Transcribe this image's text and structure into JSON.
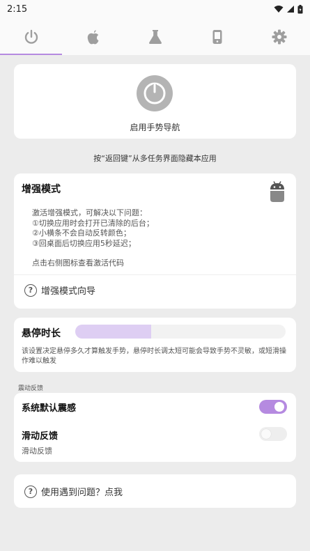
{
  "status_bar": {
    "time": "2:15",
    "icons": [
      "wifi-icon",
      "signal-icon",
      "battery-icon"
    ]
  },
  "tabs": [
    {
      "icon": "power-icon",
      "active": true
    },
    {
      "icon": "apple-icon",
      "active": false
    },
    {
      "icon": "flask-icon",
      "active": false
    },
    {
      "icon": "phone-icon",
      "active": false
    },
    {
      "icon": "gear-icon",
      "active": false
    }
  ],
  "power_card": {
    "label": "启用手势导航"
  },
  "hint": "按“返回键”从多任务界面隐藏本应用",
  "enhance_card": {
    "title": "增强模式",
    "desc_lines": [
      "激活增强模式，可解决以下问题：",
      "①切换应用时会打开已清除的后台；",
      "②小横条不会自动反转颜色；",
      "③回桌面后切换应用5秒延迟；"
    ],
    "tip": "点击右侧图标查看激活代码",
    "guide_label": "增强模式向导"
  },
  "hover_card": {
    "title": "悬停时长",
    "slider_fraction": 0.36,
    "desc": "该设置决定悬停多久才算触发手势，悬停时长调太短可能会导致手势不灵敏，或短滑操作难以触发"
  },
  "feedback_section": {
    "label": "震动反馈",
    "row1_label": "系统默认震感",
    "row1_on": true,
    "row2_label": "滑动反馈",
    "row2_sub": "滑动反馈",
    "row2_on": false
  },
  "help_card": {
    "label": "使用遇到问题？点我"
  },
  "colors": {
    "accent": "#b58ae0",
    "slider_fill": "#decef3",
    "background": "#ececec"
  }
}
